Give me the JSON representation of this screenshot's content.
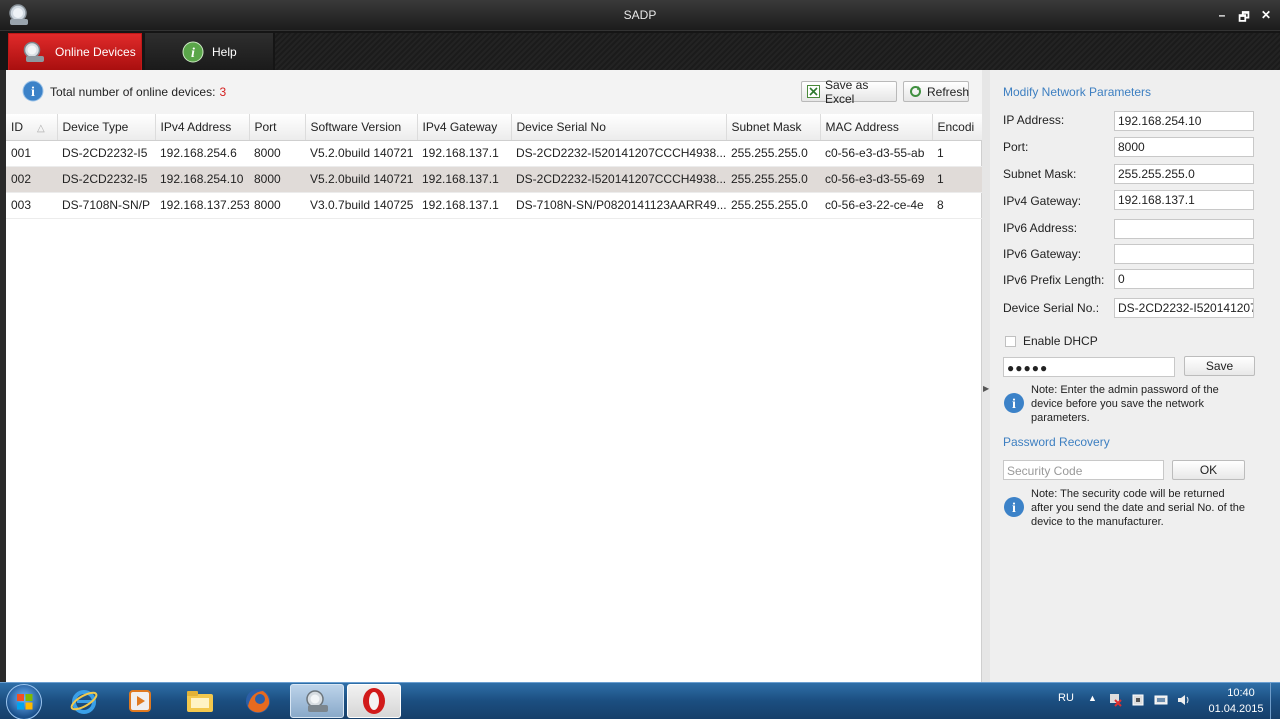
{
  "window": {
    "title": "SADP",
    "controls": [
      "–",
      "🗗",
      "✕"
    ]
  },
  "tabs": [
    {
      "label": "Online Devices",
      "icon": "magnifier-device-icon"
    },
    {
      "label": "Help",
      "icon": "info-icon"
    }
  ],
  "toolbar": {
    "count_label": "Total number of online devices:",
    "count_value": "3",
    "save_excel_label": "Save as Excel",
    "refresh_label": "Refresh"
  },
  "table": {
    "headers": [
      "ID",
      "Device Type",
      "IPv4 Address",
      "Port",
      "Software Version",
      "IPv4 Gateway",
      "Device Serial No",
      "Subnet Mask",
      "MAC Address",
      "Encodi"
    ],
    "rows": [
      [
        "001",
        "DS-2CD2232-I5",
        "192.168.254.6",
        "8000",
        "V5.2.0build 140721",
        "192.168.137.1",
        "DS-2CD2232-I520141207CCCH4938...",
        "255.255.255.0",
        "c0-56-e3-d3-55-ab",
        "1"
      ],
      [
        "002",
        "DS-2CD2232-I5",
        "192.168.254.10",
        "8000",
        "V5.2.0build 140721",
        "192.168.137.1",
        "DS-2CD2232-I520141207CCCH4938...",
        "255.255.255.0",
        "c0-56-e3-d3-55-69",
        "1"
      ],
      [
        "003",
        "DS-7108N-SN/P",
        "192.168.137.253",
        "8000",
        "V3.0.7build 140725",
        "192.168.137.1",
        "DS-7108N-SN/P0820141123AARR49...",
        "255.255.255.0",
        "c0-56-e3-22-ce-4e",
        "8"
      ]
    ],
    "selected_row": 1
  },
  "modify": {
    "title": "Modify Network Parameters",
    "fields": [
      {
        "label": "IP Address:",
        "value": "192.168.254.10"
      },
      {
        "label": "Port:",
        "value": "8000"
      },
      {
        "label": "Subnet Mask:",
        "value": "255.255.255.0"
      },
      {
        "label": "IPv4 Gateway:",
        "value": "192.168.137.1"
      },
      {
        "label": "IPv6 Address:",
        "value": ""
      },
      {
        "label": "IPv6 Gateway:",
        "value": ""
      },
      {
        "label": "IPv6 Prefix Length:",
        "value": "0"
      },
      {
        "label": "Device Serial No.:",
        "value": "DS-2CD2232-I520141207"
      }
    ],
    "dhcp_label": "Enable DHCP",
    "dhcp_checked": false,
    "password_value": "●●●●●",
    "save_label": "Save",
    "note": "Note: Enter the admin password of the device before you save the network parameters."
  },
  "recovery": {
    "title": "Password Recovery",
    "security_placeholder": "Security Code",
    "ok_label": "OK",
    "note": "Note: The security code will be returned after you send the date and serial No. of the device to the manufacturer."
  },
  "taskbar": {
    "apps": [
      "internet-explorer-icon",
      "media-player-icon",
      "file-explorer-icon",
      "firefox-icon",
      "sadp-icon",
      "opera-icon"
    ],
    "lang": "RU",
    "time": "10:40",
    "date": "01.04.2015"
  }
}
